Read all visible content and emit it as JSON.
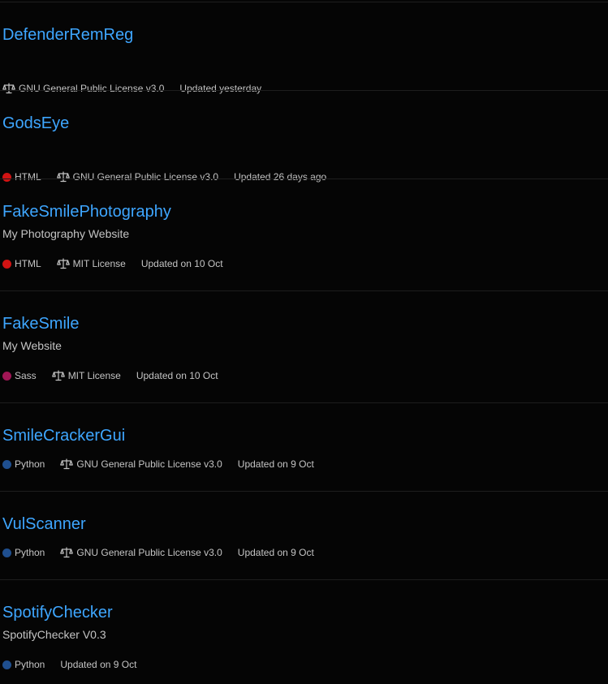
{
  "repos": [
    {
      "name": "DefenderRemReg",
      "description": "",
      "language": "",
      "language_color": "",
      "license": "GNU General Public License v3.0",
      "updated": "Updated yesterday"
    },
    {
      "name": "GodsEye",
      "description": "",
      "language": "HTML",
      "language_color": "#d11313",
      "license": "GNU General Public License v3.0",
      "updated": "Updated 26 days ago"
    },
    {
      "name": "FakeSmilePhotography",
      "description": "My Photography Website",
      "language": "HTML",
      "language_color": "#d11313",
      "license": "MIT License",
      "updated": "Updated on 10 Oct"
    },
    {
      "name": "FakeSmile",
      "description": "My Website",
      "language": "Sass",
      "language_color": "#a01655",
      "license": "MIT License",
      "updated": "Updated on 10 Oct"
    },
    {
      "name": "SmileCrackerGui",
      "description": "",
      "language": "Python",
      "language_color": "#1f4f8f",
      "license": "GNU General Public License v3.0",
      "updated": "Updated on 9 Oct"
    },
    {
      "name": "VulScanner",
      "description": "",
      "language": "Python",
      "language_color": "#1f4f8f",
      "license": "GNU General Public License v3.0",
      "updated": "Updated on 9 Oct"
    },
    {
      "name": "SpotifyChecker",
      "description": "SpotifyChecker V0.3",
      "language": "Python",
      "language_color": "#1f4f8f",
      "license": "",
      "updated": "Updated on 9 Oct"
    }
  ],
  "icons": {
    "license": "scale-icon",
    "language": "language-dot"
  }
}
